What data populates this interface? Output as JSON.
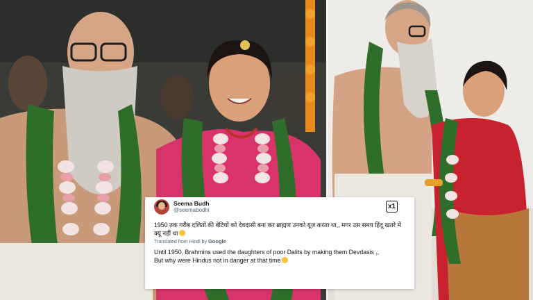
{
  "tweet": {
    "display_name": "Seema Budh",
    "handle": "@seemabodhi",
    "logo_text": "x1",
    "hindi_text": "1950 तक गरीब दलितों की बेटियों को देवदासी बना कर ब्राह्मण उनको यूज़ करता था,, मगर उस समय हिंदू खतरे में क्यूं नहीं था",
    "translated_label": "Translated from Hindi by",
    "translated_brand": "Google",
    "english_line1": "Until 1950, Brahmins used the daughters of poor Dalits by making them Devdasis ,,",
    "english_line2": "But why were Hindus not in danger at that time",
    "emoji": "thinking-face-icon"
  },
  "colors": {
    "garland_green": "#2f6e2a",
    "marigold": "#e98a1f",
    "saree_pink": "#d8336b",
    "saree_red": "#c8222f"
  }
}
